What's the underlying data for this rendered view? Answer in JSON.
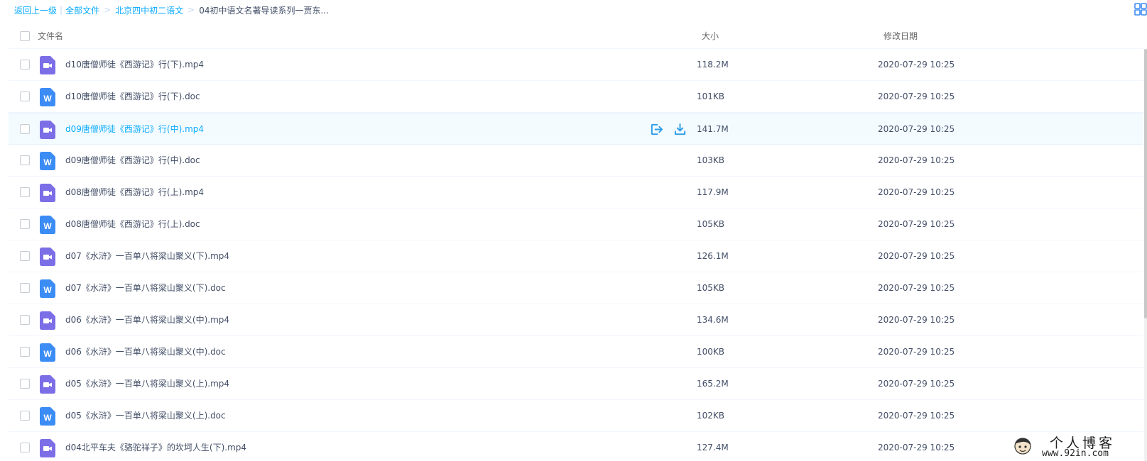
{
  "breadcrumb": {
    "back": "返回上一级",
    "separator_bar": "|",
    "separator": ">",
    "items": [
      "全部文件",
      "北京四中初二语文"
    ],
    "current": "04初中语文名著导读系列一贾东..."
  },
  "table": {
    "headers": {
      "name": "文件名",
      "size": "大小",
      "date": "修改日期"
    }
  },
  "files": [
    {
      "name": "d10唐僧师徒《西游记》行(下).mp4",
      "type": "video",
      "size": "118.2M",
      "date": "2020-07-29 10:25"
    },
    {
      "name": "d10唐僧师徒《西游记》行(下).doc",
      "type": "doc",
      "size": "101KB",
      "date": "2020-07-29 10:25"
    },
    {
      "name": "d09唐僧师徒《西游记》行(中).mp4",
      "type": "video",
      "size": "141.7M",
      "date": "2020-07-29 10:25",
      "hover": true
    },
    {
      "name": "d09唐僧师徒《西游记》行(中).doc",
      "type": "doc",
      "size": "103KB",
      "date": "2020-07-29 10:25"
    },
    {
      "name": "d08唐僧师徒《西游记》行(上).mp4",
      "type": "video",
      "size": "117.9M",
      "date": "2020-07-29 10:25"
    },
    {
      "name": "d08唐僧师徒《西游记》行(上).doc",
      "type": "doc",
      "size": "105KB",
      "date": "2020-07-29 10:25"
    },
    {
      "name": "d07《水浒》一百单八将梁山聚义(下).mp4",
      "type": "video",
      "size": "126.1M",
      "date": "2020-07-29 10:25"
    },
    {
      "name": "d07《水浒》一百单八将梁山聚义(下).doc",
      "type": "doc",
      "size": "105KB",
      "date": "2020-07-29 10:25"
    },
    {
      "name": "d06《水浒》一百单八将梁山聚义(中).mp4",
      "type": "video",
      "size": "134.6M",
      "date": "2020-07-29 10:25"
    },
    {
      "name": "d06《水浒》一百单八将梁山聚义(中).doc",
      "type": "doc",
      "size": "100KB",
      "date": "2020-07-29 10:25"
    },
    {
      "name": "d05《水浒》一百单八将梁山聚义(上).mp4",
      "type": "video",
      "size": "165.2M",
      "date": "2020-07-29 10:25"
    },
    {
      "name": "d05《水浒》一百单八将梁山聚义(上).doc",
      "type": "doc",
      "size": "102KB",
      "date": "2020-07-29 10:25"
    },
    {
      "name": "d04北平车夫《骆驼祥子》的坎坷人生(下).mp4",
      "type": "video",
      "size": "127.4M",
      "date": "2020-07-29 10:25"
    }
  ],
  "icons": {
    "video": "video-file-icon",
    "doc": "word-doc-icon",
    "share": "share-icon",
    "download": "download-icon",
    "grid": "grid-view-icon"
  },
  "colors": {
    "accent": "#09aaff",
    "video_icon": "#7b6ee6",
    "doc_icon": "#3c8cf5",
    "action_icon": "#2b9bea"
  },
  "watermark": {
    "title": "个人博客",
    "url": "www.92in.com"
  }
}
